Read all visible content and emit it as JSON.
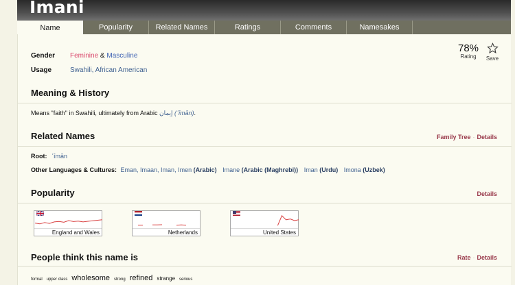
{
  "name": "Imani",
  "tabs": [
    "Name",
    "Popularity",
    "Related Names",
    "Ratings",
    "Comments",
    "Namesakes"
  ],
  "info": {
    "gender_label": "Gender",
    "gender_fem": "Feminine",
    "gender_amp": "&",
    "gender_masc": "Masculine",
    "usage_label": "Usage",
    "usage_value": "Swahili, African American"
  },
  "rating": {
    "value": "78%",
    "label": "Rating",
    "save_label": "Save"
  },
  "meaning": {
    "title": "Meaning & History",
    "text_prefix": "Means \"faith\" in Swahili, ultimately from Arabic ",
    "arabic": "إيمان",
    "translit": "(ʾīmān)",
    "text_suffix": "."
  },
  "related": {
    "title": "Related Names",
    "link_family_tree": "Family Tree",
    "link_details": "Details",
    "root_label": "Root:",
    "root_value": "ʾīmān",
    "other_label": "Other Languages & Cultures:",
    "groups": [
      {
        "names": "Eman, Imaan, Iman, Imen",
        "lang": "(Arabic)"
      },
      {
        "names": "Imane",
        "lang": "(Arabic (Maghrebi))"
      },
      {
        "names": "Iman",
        "lang": "(Urdu)"
      },
      {
        "names": "Imona",
        "lang": "(Uzbek)"
      }
    ]
  },
  "popularity": {
    "title": "Popularity",
    "link_details": "Details",
    "charts": [
      {
        "country": "England and Wales",
        "flag": "uk-flag",
        "values": [
          0.35,
          0.3,
          0.38,
          0.33,
          0.42,
          0.45,
          0.4,
          0.5,
          0.44,
          0.47,
          0.42,
          0.46,
          0.49,
          0.52,
          0.55
        ]
      },
      {
        "country": "Netherlands",
        "flag": "netherlands-flag",
        "values": [
          0,
          0.22,
          0.22,
          0,
          0.24,
          0.24,
          0.25,
          0,
          0,
          0.22,
          0.24,
          0.22,
          0,
          0,
          0
        ]
      },
      {
        "country": "United States",
        "flag": "us-flag",
        "values": [
          0,
          0,
          0,
          0,
          0,
          0,
          0,
          0,
          0,
          0,
          0,
          0.2,
          0.8,
          0.55,
          0.6,
          0.5,
          0.55
        ]
      }
    ]
  },
  "people_think": {
    "title": "People think this name is",
    "link_rate": "Rate",
    "link_details": "Details",
    "tags": [
      {
        "text": "formal",
        "size": 6
      },
      {
        "text": "upper class",
        "size": 6
      },
      {
        "text": "wholesome",
        "size": 11
      },
      {
        "text": "strong",
        "size": 6
      },
      {
        "text": "refined",
        "size": 11
      },
      {
        "text": "strange",
        "size": 8
      },
      {
        "text": "serious",
        "size": 6
      }
    ]
  }
}
